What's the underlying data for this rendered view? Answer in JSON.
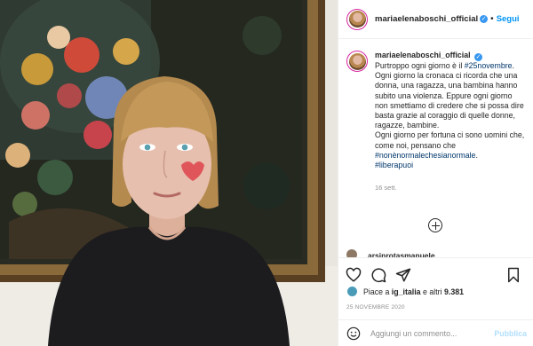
{
  "post": {
    "username": "mariaelenaboschi_official",
    "follow_label": "Segui",
    "dot": "•",
    "caption_parts": {
      "t1": "Purtroppo ogni giorno è il ",
      "h1": "#25novembre",
      "t2": ". Ogni giorno la cronaca ci ricorda che una donna, una ragazza, una bambina hanno subito una violenza. Eppure ogni giorno non smettiamo di credere che si possa dire basta grazie al coraggio di quelle donne, ragazze, bambine.",
      "t3": "Ogni giorno per fortuna ci sono uomini che, come noi, pensano che ",
      "h2": "#nonènormalechesianormale",
      "t4": ".",
      "h3": "#liberapuoi"
    },
    "time_ago": "16 sett.",
    "comment_peek_user": "arsinrotasmanuele",
    "likes": {
      "prefix": "Piace a ",
      "user": "ig_italia",
      "middle": " e altri ",
      "count": "9.381"
    },
    "date": "25 NOVEMBRE 2020",
    "comment_placeholder": "Aggiungi un commento...",
    "publish_label": "Pubblica"
  },
  "colors": {
    "accent": "#0095f6",
    "hashtag": "#00376b",
    "muted": "#8e8e8e",
    "publish_disabled": "#b2dffc",
    "cheek_heart": "#e0555a"
  },
  "icons": {
    "actions": [
      "heart-icon",
      "comment-icon",
      "share-icon",
      "bookmark-icon"
    ],
    "load_more": "plus-circle-icon",
    "emoji": "smile-icon",
    "verified": "verified-badge-icon"
  }
}
